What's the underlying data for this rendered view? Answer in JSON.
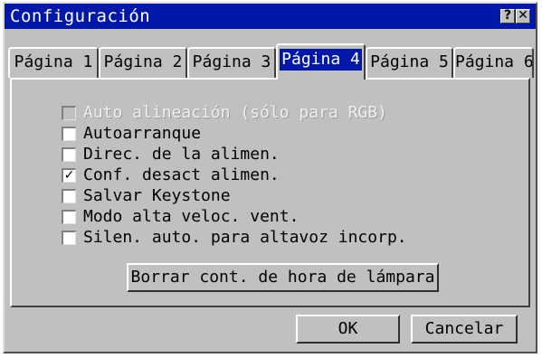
{
  "window": {
    "title": "Configuración",
    "help_glyph": "?",
    "close_glyph": "✕"
  },
  "tabs": [
    {
      "label": "Página 1",
      "active": false
    },
    {
      "label": "Página 2",
      "active": false
    },
    {
      "label": "Página 3",
      "active": false
    },
    {
      "label": "Página 4",
      "active": true
    },
    {
      "label": "Página 5",
      "active": false
    },
    {
      "label": "Página 6",
      "active": false
    }
  ],
  "options": [
    {
      "label": "Auto alineación (sólo para RGB)",
      "checked": false,
      "enabled": false
    },
    {
      "label": "Autoarranque",
      "checked": false,
      "enabled": true
    },
    {
      "label": "Direc. de la alimen.",
      "checked": false,
      "enabled": true
    },
    {
      "label": "Conf. desact alimen.",
      "checked": true,
      "enabled": true
    },
    {
      "label": "Salvar Keystone",
      "checked": false,
      "enabled": true
    },
    {
      "label": "Modo alta veloc. vent.",
      "checked": false,
      "enabled": true
    },
    {
      "label": "Silen. auto. para altavoz incorp.",
      "checked": false,
      "enabled": true
    }
  ],
  "check_glyph": "✓",
  "reset_lamp_button": "Borrar cont. de hora de lámpara",
  "ok_button": "OK",
  "cancel_button": "Cancelar",
  "colors": {
    "titlebar": "#0018a8",
    "face": "#c0c0c0"
  }
}
